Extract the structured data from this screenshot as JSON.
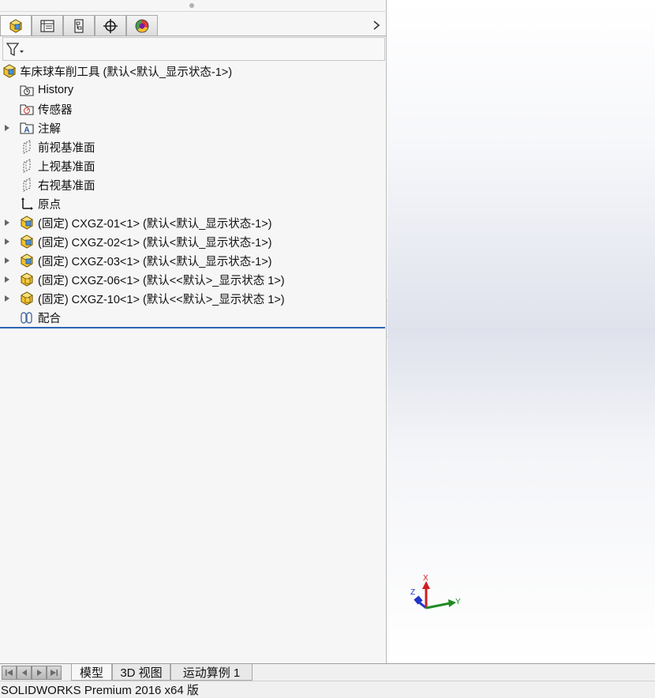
{
  "manager_tabs": [
    {
      "name": "feature-manager",
      "icon": "assembly-tree-icon",
      "active": true
    },
    {
      "name": "property-manager",
      "icon": "property-list-icon",
      "active": false
    },
    {
      "name": "configuration-manager",
      "icon": "configuration-icon",
      "active": false
    },
    {
      "name": "dimxpert-manager",
      "icon": "crosshair-target-icon",
      "active": false
    },
    {
      "name": "display-manager",
      "icon": "appearance-pie-icon",
      "active": false
    }
  ],
  "filter": {
    "icon": "funnel-filter-icon"
  },
  "tree": {
    "root": "车床球车削工具  (默认<默认_显示状态-1>)",
    "items": [
      {
        "label": "History",
        "icon": "history-folder-icon",
        "expandable": false
      },
      {
        "label": "传感器",
        "icon": "sensor-folder-icon",
        "expandable": false
      },
      {
        "label": "注解",
        "icon": "annotation-folder-icon",
        "expandable": true
      },
      {
        "label": "前视基准面",
        "icon": "plane-icon",
        "expandable": false
      },
      {
        "label": "上视基准面",
        "icon": "plane-icon",
        "expandable": false
      },
      {
        "label": "右视基准面",
        "icon": "plane-icon",
        "expandable": false
      },
      {
        "label": "原点",
        "icon": "origin-icon",
        "expandable": false
      },
      {
        "label": "(固定) CXGZ-01<1> (默认<默认_显示状态-1>)",
        "icon": "part-icon",
        "expandable": true
      },
      {
        "label": "(固定) CXGZ-02<1> (默认<默认_显示状态-1>)",
        "icon": "part-icon",
        "expandable": true
      },
      {
        "label": "(固定) CXGZ-03<1> (默认<默认_显示状态-1>)",
        "icon": "part-icon",
        "expandable": true
      },
      {
        "label": "(固定) CXGZ-06<1> (默认<<默认>_显示状态 1>)",
        "icon": "subassembly-icon",
        "expandable": true
      },
      {
        "label": "(固定) CXGZ-10<1> (默认<<默认>_显示状态 1>)",
        "icon": "subassembly-icon",
        "expandable": true
      },
      {
        "label": "配合",
        "icon": "mates-folder-icon",
        "expandable": false
      }
    ]
  },
  "triad": {
    "x": "X",
    "y": "Y",
    "z": "Z"
  },
  "bottom_tabs": {
    "model": "模型",
    "view3d": "3D 视图",
    "motion": "运动算例 1"
  },
  "status_bar": "SOLIDWORKS Premium 2016 x64 版",
  "colors": {
    "tree_end_line": "#2e66b4",
    "axis_x": "#d01f1f",
    "axis_y": "#1f8a24",
    "axis_z": "#1f35c8",
    "part_yellow": "#f2c12e",
    "part_blue": "#4a90d9"
  }
}
